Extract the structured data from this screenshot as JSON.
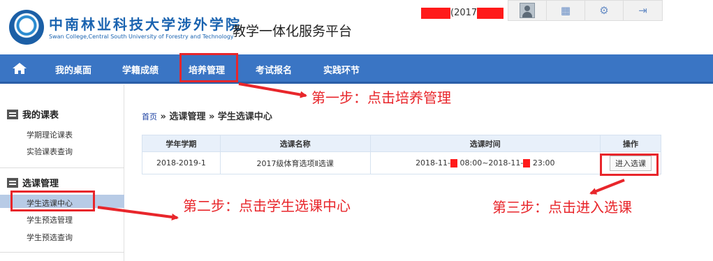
{
  "header": {
    "school_name_cn": "中南林业科技大学涉外学院",
    "school_name_en": "Swan College,Central South University of Forestry and Technology",
    "platform_title": "教学一体化服务平台",
    "user_info": "(2017",
    "toolbar_icons": [
      "avatar",
      "grid-icon",
      "gear-icon",
      "logout-icon"
    ]
  },
  "nav": {
    "items": [
      "我的桌面",
      "学籍成绩",
      "培养管理",
      "考试报名",
      "实践环节"
    ]
  },
  "sidebar": {
    "groups": [
      {
        "title": "我的课表",
        "items": [
          "学期理论课表",
          "实验课表查询"
        ]
      },
      {
        "title": "选课管理",
        "items": [
          "学生选课中心",
          "学生预选管理",
          "学生预选查询"
        ]
      }
    ]
  },
  "breadcrumb": {
    "home": "首页",
    "sep1": " » ",
    "level1": "选课管理",
    "sep2": " » ",
    "level2": "学生选课中心"
  },
  "table": {
    "headers": [
      "学年学期",
      "选课名称",
      "选课时间",
      "操作"
    ],
    "rows": [
      {
        "term": "2018-2019-1",
        "name": "2017级体育选项Ⅱ选课",
        "time_start": "2018-11-",
        "time_mid": " 08:00~2018-11-",
        "time_end": " 23:00",
        "action": "进入选课"
      }
    ]
  },
  "annotations": {
    "step1": "第一步：点击培养管理",
    "step2": "第二步：点击学生选课中心",
    "step3": "第三步：点击进入选课"
  },
  "colors": {
    "nav_bg": "#3a75c4",
    "annotation_red": "#e8262b",
    "brand_blue": "#1a63b0"
  }
}
